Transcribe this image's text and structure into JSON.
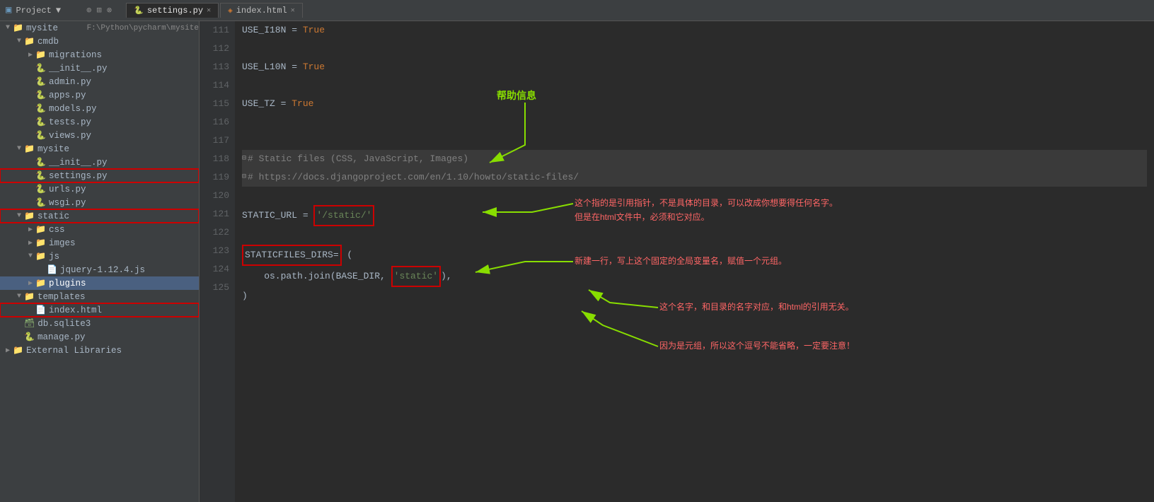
{
  "titleBar": {
    "projectLabel": "Project",
    "projectName": "mysite",
    "projectPath": "F:\\Python\\pycharm\\mysite",
    "tabs": [
      {
        "name": "settings.py",
        "type": "py",
        "active": true
      },
      {
        "name": "index.html",
        "type": "html",
        "active": false
      }
    ]
  },
  "sidebar": {
    "items": [
      {
        "id": "mysite-root",
        "label": "mysite",
        "type": "folder",
        "indent": 0,
        "open": true,
        "path": "F:\\Python\\pycharm\\mysite",
        "highlighted": false
      },
      {
        "id": "cmdb",
        "label": "cmdb",
        "type": "folder",
        "indent": 1,
        "open": true,
        "highlighted": false
      },
      {
        "id": "migrations",
        "label": "migrations",
        "type": "folder",
        "indent": 2,
        "open": false,
        "highlighted": false
      },
      {
        "id": "init-cmdb",
        "label": "__init__.py",
        "type": "py",
        "indent": 2,
        "highlighted": false
      },
      {
        "id": "admin-py",
        "label": "admin.py",
        "type": "py",
        "indent": 2,
        "highlighted": false
      },
      {
        "id": "apps-py",
        "label": "apps.py",
        "type": "py",
        "indent": 2,
        "highlighted": false
      },
      {
        "id": "models-py",
        "label": "models.py",
        "type": "py",
        "indent": 2,
        "highlighted": false
      },
      {
        "id": "tests-py",
        "label": "tests.py",
        "type": "py",
        "indent": 2,
        "highlighted": false
      },
      {
        "id": "views-py",
        "label": "views.py",
        "type": "py",
        "indent": 2,
        "highlighted": false
      },
      {
        "id": "mysite-pkg",
        "label": "mysite",
        "type": "folder",
        "indent": 1,
        "open": true,
        "highlighted": false
      },
      {
        "id": "init-mysite",
        "label": "__init__.py",
        "type": "py",
        "indent": 2,
        "highlighted": false
      },
      {
        "id": "settings-py",
        "label": "settings.py",
        "type": "py",
        "indent": 2,
        "highlighted": true,
        "redBorder": true
      },
      {
        "id": "urls-py",
        "label": "urls.py",
        "type": "py",
        "indent": 2,
        "highlighted": false
      },
      {
        "id": "wsgi-py",
        "label": "wsgi.py",
        "type": "py",
        "indent": 2,
        "highlighted": false
      },
      {
        "id": "static",
        "label": "static",
        "type": "folder",
        "indent": 1,
        "open": true,
        "highlighted": false,
        "redBorder": true
      },
      {
        "id": "css",
        "label": "css",
        "type": "folder",
        "indent": 2,
        "open": false,
        "highlighted": false
      },
      {
        "id": "imges",
        "label": "imges",
        "type": "folder",
        "indent": 2,
        "open": false,
        "highlighted": false
      },
      {
        "id": "js",
        "label": "js",
        "type": "folder",
        "indent": 2,
        "open": true,
        "highlighted": false
      },
      {
        "id": "jquery",
        "label": "jquery-1.12.4.js",
        "type": "py",
        "indent": 3,
        "highlighted": false
      },
      {
        "id": "plugins",
        "label": "plugins",
        "type": "folder",
        "indent": 2,
        "open": false,
        "highlighted": false,
        "selected": true
      },
      {
        "id": "templates",
        "label": "templates",
        "type": "folder",
        "indent": 1,
        "open": true,
        "highlighted": false
      },
      {
        "id": "index-html",
        "label": "index.html",
        "type": "html",
        "indent": 2,
        "highlighted": false,
        "redBorder": true
      },
      {
        "id": "db-sqlite3",
        "label": "db.sqlite3",
        "type": "db",
        "indent": 1,
        "highlighted": false
      },
      {
        "id": "manage-py",
        "label": "manage.py",
        "type": "py",
        "indent": 1,
        "highlighted": false
      },
      {
        "id": "external-libs",
        "label": "External Libraries",
        "type": "folder",
        "indent": 0,
        "open": false,
        "highlighted": false
      }
    ]
  },
  "editor": {
    "lines": [
      {
        "num": 111,
        "content": "USE_I18N = True",
        "type": "code"
      },
      {
        "num": 112,
        "content": "",
        "type": "empty"
      },
      {
        "num": 113,
        "content": "USE_L10N = True",
        "type": "code"
      },
      {
        "num": 114,
        "content": "",
        "type": "empty"
      },
      {
        "num": 115,
        "content": "USE_TZ = True",
        "type": "code"
      },
      {
        "num": 116,
        "content": "",
        "type": "empty"
      },
      {
        "num": 117,
        "content": "",
        "type": "empty"
      },
      {
        "num": 118,
        "content": "# Static files (CSS, JavaScript, Images)",
        "type": "comment",
        "foldable": true
      },
      {
        "num": 119,
        "content": "# https://docs.djangoproject.com/en/1.10/howto/static-files/",
        "type": "comment",
        "foldable": true
      },
      {
        "num": 120,
        "content": "",
        "type": "empty"
      },
      {
        "num": 121,
        "content": "STATIC_URL = '/static/'",
        "type": "code",
        "hasRedBox": true,
        "redBoxPart": "'/static/'"
      },
      {
        "num": 122,
        "content": "",
        "type": "empty"
      },
      {
        "num": 123,
        "content": "STATICFILES_DIRS= (",
        "type": "code",
        "hasRedBox": true,
        "redBoxPart": "STATICFILES_DIRS="
      },
      {
        "num": 124,
        "content": "    os.path.join(BASE_DIR, 'static'),",
        "type": "code",
        "hasRedBox": true,
        "redBoxPart": "'static'"
      },
      {
        "num": 125,
        "content": ")",
        "type": "code"
      }
    ]
  },
  "annotations": {
    "helpLabel": "帮助信息",
    "annotation1": "这个指的是引用指针，不是具体的目录，可以改成你想要得任何名字。",
    "annotation1b": "但是在html文件中，必须和它对应。",
    "annotation2": "新建一行，写上这个固定的全局变量名，赋值一个元组。",
    "annotation3": "这个名字，和目录的名字对应，和html的引用无关。",
    "annotation4": "因为是元组，所以这个逗号不能省略，一定要注意！"
  }
}
